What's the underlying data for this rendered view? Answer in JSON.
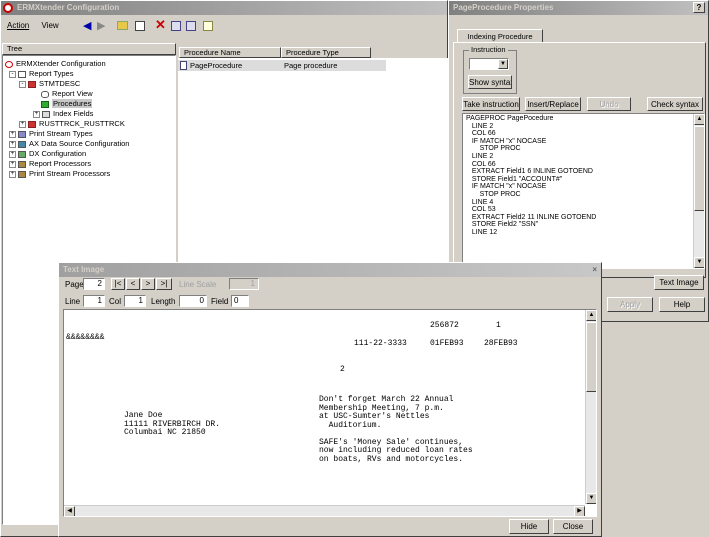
{
  "erm_window": {
    "title": "ERMXtender Configuration",
    "menu": [
      "Action",
      "View"
    ],
    "tree_header": "Tree",
    "columns": [
      "Procedure Name",
      "Procedure Type"
    ],
    "rows": [
      {
        "name": "PageProcedure",
        "type": "Page procedure"
      }
    ],
    "tree": [
      {
        "label": "ERMXtender Configuration",
        "level": 0
      },
      {
        "label": "Report Types",
        "level": 1
      },
      {
        "label": "STMTDESC",
        "level": 2
      },
      {
        "label": "Report View",
        "level": 3
      },
      {
        "label": "Procedures",
        "level": 3
      },
      {
        "label": "Index Fields",
        "level": 3
      },
      {
        "label": "RUSTTRCK_RUSTTRCK",
        "level": 2
      },
      {
        "label": "Print Stream Types",
        "level": 1
      },
      {
        "label": "AX Data Source Configuration",
        "level": 1
      },
      {
        "label": "DX Configuration",
        "level": 1
      },
      {
        "label": "Report Processors",
        "level": 1
      },
      {
        "label": "Print Stream Processors",
        "level": 1
      }
    ]
  },
  "props_window": {
    "title": "PageProcedure Properties",
    "help_glyph": "?",
    "tab": "Indexing Procedure",
    "instruction_label": "Instruction",
    "show_syntax": "Show syntax",
    "take_instruction": "Take instruction",
    "insert_replace": "Insert/Replace",
    "undo": "Undo",
    "check_syntax": "Check syntax",
    "text_image_btn": "Text Image",
    "apply": "Apply",
    "help": "Help",
    "code": [
      "PAGEPROC PagePocedure",
      "   LINE 2",
      "   COL 66",
      "   IF MATCH \"x\" NOCASE",
      "       STOP PROC",
      "   LINE 2",
      "   COL 66",
      "   EXTRACT Field1 6 INLINE GOTOEND",
      "   STORE Field1 \"ACCOUNT#\"",
      "   IF MATCH \"x\" NOCASE",
      "       STOP PROC",
      "   LINE 4",
      "   COL 53",
      "   EXTRACT Field2 11 INLINE GOTOEND",
      "   STORE Field2 \"SSN\"",
      "   LINE 12"
    ]
  },
  "text_image": {
    "title": "Text Image",
    "page_label": "Page",
    "page_value": "2",
    "nav_first": "|<",
    "nav_prev": "<",
    "nav_next": ">",
    "nav_last": ">|",
    "line_scale_label": "Line Scale",
    "line_scale_value": "1",
    "line_label": "Line",
    "line_value": "1",
    "col_label": "Col",
    "col_value": "1",
    "length_label": "Length",
    "length_value": "0",
    "field_label": "Field",
    "field_value": "0",
    "hide": "Hide",
    "close": "Close",
    "doc": {
      "num1": "256872",
      "num2": "1",
      "marks": "&&&&&&&&",
      "ssn": "111-22-3333",
      "date1": "01FEB93",
      "date2": "28FEB93",
      "page_no": "2",
      "address": "Jane Doe\n11111 RIVERBIRCH DR.\nColumbai NC 21850",
      "notice": "Don't forget March 22 Annual\nMembership Meeting, 7 p.m.\nat USC-Sumter's Nettles\n  Auditorium.\n\nSAFE's 'Money Sale' continues,\nnow including reduced loan rates\non boats, RVs and motorcycles."
    }
  }
}
